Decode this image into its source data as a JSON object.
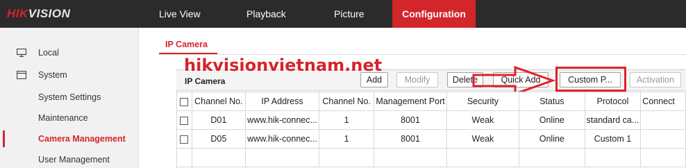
{
  "brand": {
    "logo_red": "HIK",
    "logo_white": "VISION"
  },
  "nav": {
    "live_view": "Live View",
    "playback": "Playback",
    "picture": "Picture",
    "configuration": "Configuration"
  },
  "sidebar": {
    "items": [
      {
        "label": "Local",
        "icon": "monitor-icon"
      },
      {
        "label": "System",
        "icon": "system-icon"
      },
      {
        "label": "System Settings"
      },
      {
        "label": "Maintenance"
      },
      {
        "label": "Camera Management"
      },
      {
        "label": "User Management"
      }
    ],
    "active": "Camera Management"
  },
  "tab": {
    "label": "IP Camera"
  },
  "panel": {
    "title": "IP Camera",
    "buttons": {
      "add": "Add",
      "modify": "Modify",
      "delete": "Delete",
      "quick_add": "Quick Add",
      "custom_protocol": "Custom P...",
      "activation": "Activation"
    }
  },
  "watermark": "hikvisionvietnam.net",
  "table": {
    "headers": [
      "Channel No.",
      "IP Address",
      "Channel No.",
      "Management Port",
      "Security",
      "Status",
      "Protocol",
      "Connect"
    ],
    "rows": [
      [
        "D01",
        "www.hik-connec...",
        "1",
        "8001",
        "Weak",
        "Online",
        "standard ca...",
        ""
      ],
      [
        "D05",
        "www.hik-connec...",
        "1",
        "8001",
        "Weak",
        "Online",
        "Custom 1",
        ""
      ]
    ]
  },
  "colors": {
    "accent": "#d3262b",
    "topbar": "#2b2b2b",
    "sidebar": "#f1f1f1"
  }
}
